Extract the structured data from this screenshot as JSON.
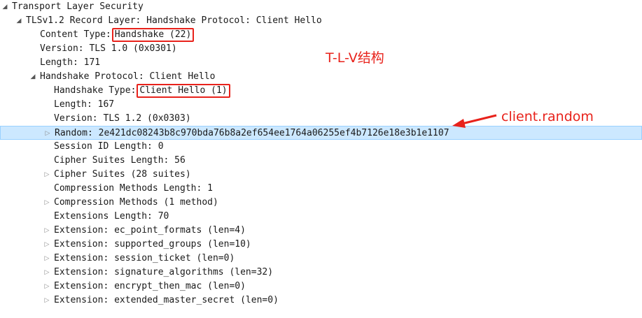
{
  "tree": {
    "rows": [
      {
        "indent": 0,
        "toggle": "expanded",
        "text": "Transport Layer Security"
      },
      {
        "indent": 1,
        "toggle": "expanded",
        "text": "TLSv1.2 Record Layer: Handshake Protocol: Client Hello"
      },
      {
        "indent": 2,
        "toggle": "none",
        "text": "Content Type:",
        "boxed_value": "Handshake (22)"
      },
      {
        "indent": 2,
        "toggle": "none",
        "text": "Version: TLS 1.0 (0x0301)"
      },
      {
        "indent": 2,
        "toggle": "none",
        "text": "Length: 171"
      },
      {
        "indent": 2,
        "toggle": "expanded",
        "text": "Handshake Protocol: Client Hello"
      },
      {
        "indent": 3,
        "toggle": "none",
        "text": "Handshake Type:",
        "boxed_value": "Client Hello (1)"
      },
      {
        "indent": 3,
        "toggle": "none",
        "text": "Length: 167"
      },
      {
        "indent": 3,
        "toggle": "none",
        "text": "Version: TLS 1.2 (0x0303)"
      },
      {
        "indent": 3,
        "toggle": "collapsed",
        "text": "Random: 2e421dc08243b8c970bda76b8a2ef654ee1764a06255ef4b7126e18e3b1e1107",
        "selected": true
      },
      {
        "indent": 3,
        "toggle": "none",
        "text": "Session ID Length: 0"
      },
      {
        "indent": 3,
        "toggle": "none",
        "text": "Cipher Suites Length: 56"
      },
      {
        "indent": 3,
        "toggle": "collapsed",
        "text": "Cipher Suites (28 suites)"
      },
      {
        "indent": 3,
        "toggle": "none",
        "text": "Compression Methods Length: 1"
      },
      {
        "indent": 3,
        "toggle": "collapsed",
        "text": "Compression Methods (1 method)"
      },
      {
        "indent": 3,
        "toggle": "none",
        "text": "Extensions Length: 70"
      },
      {
        "indent": 3,
        "toggle": "collapsed",
        "text": "Extension: ec_point_formats (len=4)"
      },
      {
        "indent": 3,
        "toggle": "collapsed",
        "text": "Extension: supported_groups (len=10)"
      },
      {
        "indent": 3,
        "toggle": "collapsed",
        "text": "Extension: session_ticket (len=0)"
      },
      {
        "indent": 3,
        "toggle": "collapsed",
        "text": "Extension: signature_algorithms (len=32)"
      },
      {
        "indent": 3,
        "toggle": "collapsed",
        "text": "Extension: encrypt_then_mac (len=0)"
      },
      {
        "indent": 3,
        "toggle": "collapsed",
        "text": "Extension: extended_master_secret (len=0)"
      }
    ]
  },
  "annotations": {
    "tlv": "T-L-V结构",
    "client_random": "client.random"
  },
  "colors": {
    "annotation": "#e8221b",
    "selection_bg": "#cce8ff",
    "selection_border": "#99d1ff"
  },
  "icons": {
    "expanded": "triangle-down-icon",
    "collapsed": "triangle-right-icon"
  }
}
